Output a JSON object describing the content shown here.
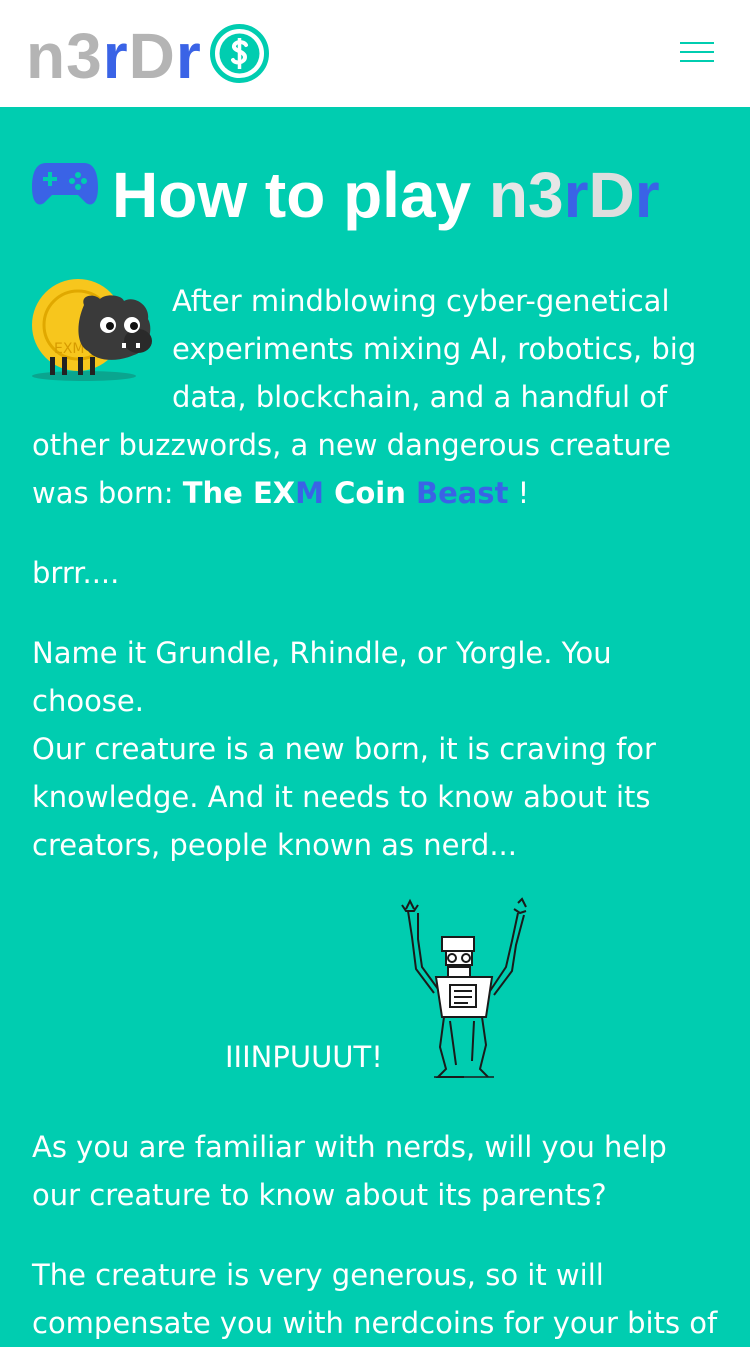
{
  "header": {
    "logo": {
      "part1": "n3",
      "part2": "r",
      "part3": "D",
      "part4": "r"
    },
    "logo_icon": "dollar-coin-icon",
    "menu_icon": "hamburger-menu-icon"
  },
  "colors": {
    "background": "#00cdb0",
    "header_background": "#ffffff",
    "brand_gray": "#b4b4b4",
    "brand_blue": "#3a63e6",
    "text": "#ffffff"
  },
  "main": {
    "title_icon": "gamepad-icon",
    "title_text": "How to play ",
    "title_brand": {
      "part1": "n3",
      "part2": "r",
      "part3": "D",
      "part4": "r"
    },
    "intro": {
      "text": "After mindblowing cyber-genetical experiments mixing AI, robotics, big data, blockchain, and a handful of other buzzwords, a new dangerous creature was born: ",
      "beast_name_1": "The EX",
      "beast_name_2": "M",
      "beast_name_3": " Coin ",
      "beast_name_4": "Beast",
      "end": " !"
    },
    "brrr": "brrr....",
    "name_line": "Name it Grundle, Rhindle, or Yorgle. You choose.",
    "creature_line": "Our creature is a new born, it is craving for knowledge. And it needs to know about its creators, people known as nerd...",
    "input_shout": "IIINPUUUT!",
    "help_line": "As you are familiar with nerds, will you help our creature to know about its parents?",
    "generous_line": "The creature is very generous, so it will compensate you with nerdcoins for your bits of"
  }
}
